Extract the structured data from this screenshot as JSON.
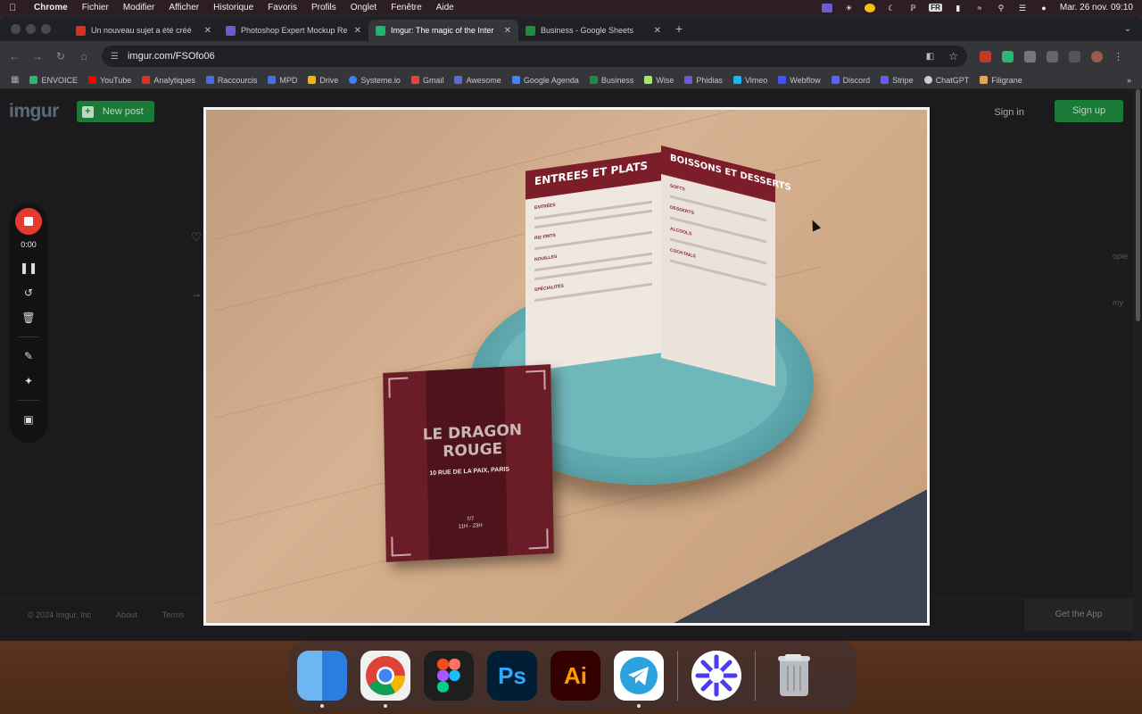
{
  "menubar": {
    "app": "Chrome",
    "items": [
      "Fichier",
      "Modifier",
      "Afficher",
      "Historique",
      "Favoris",
      "Profils",
      "Onglet",
      "Fenêtre",
      "Aide"
    ],
    "input_source": "FR",
    "datetime": "Mar. 26 nov.  09:10"
  },
  "tabs": [
    {
      "title": "Un nouveau sujet a été créé",
      "color": "#d93025"
    },
    {
      "title": "Photoshop Expert Mockup Re",
      "color": "#6e5ad6"
    },
    {
      "title": "Imgur: The magic of the Inter",
      "color": "#1bb76e"
    },
    {
      "title": "Business - Google Sheets",
      "color": "#1e8e3e"
    }
  ],
  "address": {
    "url": "imgur.com/FSOfo06"
  },
  "bookmarks": [
    {
      "label": "ENVOICE",
      "color": "#2bb673"
    },
    {
      "label": "YouTube",
      "color": "#ff0000"
    },
    {
      "label": "Analytiques",
      "color": "#e52d27"
    },
    {
      "label": "Raccourcis",
      "color": "#4a6ee0"
    },
    {
      "label": "MPD",
      "color": "#4a6ee0"
    },
    {
      "label": "Drive",
      "color": "#f4b400"
    },
    {
      "label": "Systeme.io",
      "color": "#3b82f6"
    },
    {
      "label": "Gmail",
      "color": "#ea4335"
    },
    {
      "label": "Awesome",
      "color": "#5a6cd0"
    },
    {
      "label": "Google Agenda",
      "color": "#4285f4"
    },
    {
      "label": "Business",
      "color": "#1e8e3e"
    },
    {
      "label": "Wise",
      "color": "#9fe870"
    },
    {
      "label": "Phidias",
      "color": "#6e5ad6"
    },
    {
      "label": "Vimeo",
      "color": "#1ab7ea"
    },
    {
      "label": "Webflow",
      "color": "#4353ff"
    },
    {
      "label": "Discord",
      "color": "#5865f2"
    },
    {
      "label": "Stripe",
      "color": "#635bff"
    },
    {
      "label": "ChatGPT",
      "color": "#cccccc"
    },
    {
      "label": "Filigrane",
      "color": "#e8a54b"
    }
  ],
  "imgur": {
    "logo": "imgur",
    "new_post": "New post",
    "sign_in": "Sign in",
    "sign_up": "Sign up",
    "side_text_1": "ople",
    "side_text_2": "my",
    "footer": {
      "copyright": "© 2024 Imgur, Inc",
      "about": "About",
      "terms": "Terms",
      "get_app": "Get the App"
    }
  },
  "recorder": {
    "time": "0:00"
  },
  "image": {
    "menu_left_heading": "ENTREES ET PLATS",
    "menu_right_heading": "BOISSONS ET DESSERTS",
    "menu_sections": [
      "ENTRÉES",
      "RIZ FRITS",
      "NOUILLES",
      "SPÉCIALITÉS",
      "SOFTS",
      "DESSERTS",
      "ALCOOLS",
      "COCKTAILS"
    ],
    "booklet_title": "LE DRAGON ROUGE",
    "booklet_address": "10 RUE DE LA PAIX, PARIS",
    "booklet_days": "7/7",
    "booklet_hours": "11H - 23H"
  },
  "dock": [
    {
      "name": "finder",
      "label": "",
      "bg": "#3d8bf2",
      "fg": "#ffffff"
    },
    {
      "name": "chrome",
      "label": "",
      "bg": "#f1f1f1",
      "fg": "#4285f4"
    },
    {
      "name": "figma",
      "label": "",
      "bg": "#1e1e1e",
      "fg": "#f24e1e"
    },
    {
      "name": "photoshop",
      "label": "Ps",
      "bg": "#001e36",
      "fg": "#31a8ff"
    },
    {
      "name": "illustrator",
      "label": "Ai",
      "bg": "#330000",
      "fg": "#ff9a00"
    },
    {
      "name": "telegram",
      "label": "",
      "bg": "#ffffff",
      "fg": "#2aa3df"
    },
    {
      "name": "perplexity",
      "label": "",
      "bg": "#ffffff",
      "fg": "#4c3cf0"
    },
    {
      "name": "trash",
      "label": "",
      "bg": "transparent",
      "fg": "#cccccc"
    }
  ]
}
